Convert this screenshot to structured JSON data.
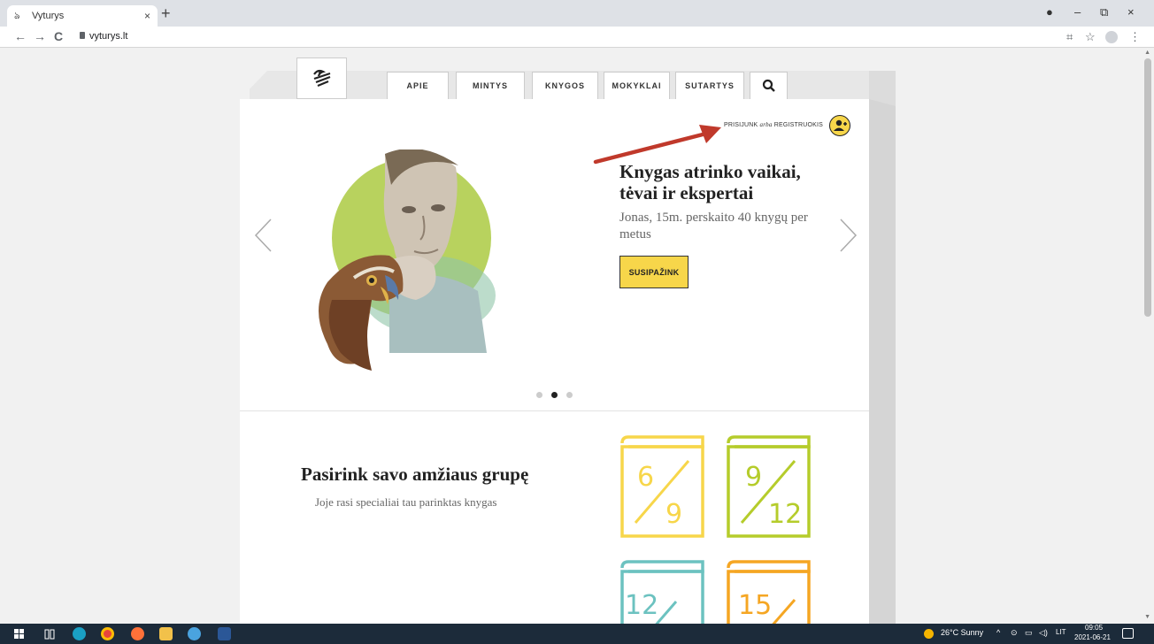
{
  "browser": {
    "tab_title": "Vyturys",
    "tab_close": "×",
    "new_tab": "+",
    "url": "vyturys.lt",
    "nav": {
      "back": "←",
      "forward": "→",
      "reload": "C"
    },
    "window": {
      "record": "●",
      "minimize": "–",
      "restore": "⧉",
      "close": "×"
    },
    "toolbar_right": {
      "qr": "⌗",
      "star": "☆",
      "menu": "⋮"
    }
  },
  "site": {
    "menu": [
      "APIE",
      "MINTYS",
      "KNYGOS",
      "MOKYKLAI",
      "SUTARTYS"
    ],
    "search_icon": "search-icon",
    "login": {
      "login": "PRISIJUNK",
      "or": "arba",
      "register": "REGISTRUOKIS"
    },
    "hero": {
      "title": "Knygas atrinko vaikai, tėvai ir ekspertai",
      "subtitle": "Jonas, 15m. perskaito 40 knygų per metus",
      "cta": "SUSIPAŽINK"
    },
    "carousel": {
      "active_index": 1,
      "count": 3
    },
    "age_section": {
      "title": "Pasirink savo amžiaus grupę",
      "subtitle": "Joje rasi specialiai tau parinktas knygas",
      "books": [
        {
          "top": "6",
          "bottom": "9",
          "color": "#f7d64a"
        },
        {
          "top": "9",
          "bottom": "12",
          "color": "#b5cc2b"
        },
        {
          "top": "12",
          "bottom": "",
          "color": "#6cc2c0"
        },
        {
          "top": "15",
          "bottom": "",
          "color": "#f5a623"
        }
      ]
    },
    "colors": {
      "accent": "#f7d64a",
      "annotation_arrow": "#c0392b"
    }
  },
  "taskbar": {
    "weather": "26°C  Sunny",
    "lang": "LIT",
    "time": "09:05",
    "date": "2021-06-21"
  }
}
